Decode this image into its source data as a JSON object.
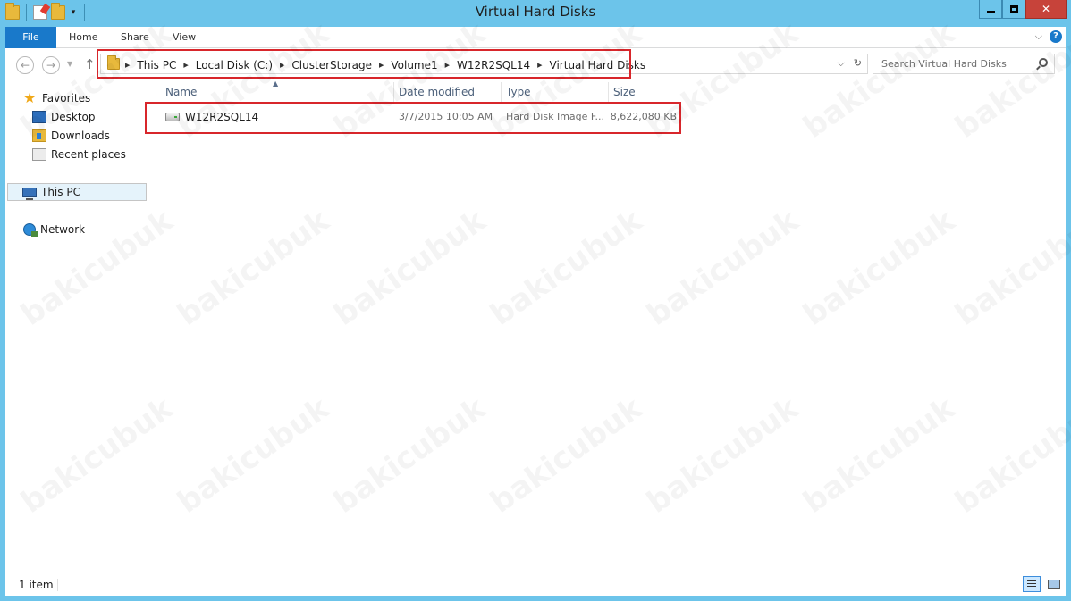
{
  "window": {
    "title": "Virtual Hard Disks"
  },
  "ribbon": {
    "tabs": [
      {
        "label": "File"
      },
      {
        "label": "Home"
      },
      {
        "label": "Share"
      },
      {
        "label": "View"
      }
    ],
    "help_label": "?"
  },
  "address": {
    "crumbs": [
      "This PC",
      "Local Disk (C:)",
      "ClusterStorage",
      "Volume1",
      "W12R2SQL14",
      "Virtual Hard Disks"
    ]
  },
  "search": {
    "placeholder": "Search Virtual Hard Disks"
  },
  "navpane": {
    "favorites": "Favorites",
    "desktop": "Desktop",
    "downloads": "Downloads",
    "recent": "Recent places",
    "thispc": "This PC",
    "network": "Network"
  },
  "columns": {
    "name": "Name",
    "date": "Date modified",
    "type": "Type",
    "size": "Size"
  },
  "files": [
    {
      "name": "W12R2SQL14",
      "date": "3/7/2015 10:05 AM",
      "type": "Hard Disk Image F...",
      "size": "8,622,080 KB"
    }
  ],
  "status": {
    "count": "1 item"
  },
  "watermark": "bakicubuk",
  "colors": {
    "titlebar": "#6cc4ea",
    "file_tab": "#1979ca",
    "highlight_box": "#d8262b",
    "close_button": "#c7433a"
  }
}
